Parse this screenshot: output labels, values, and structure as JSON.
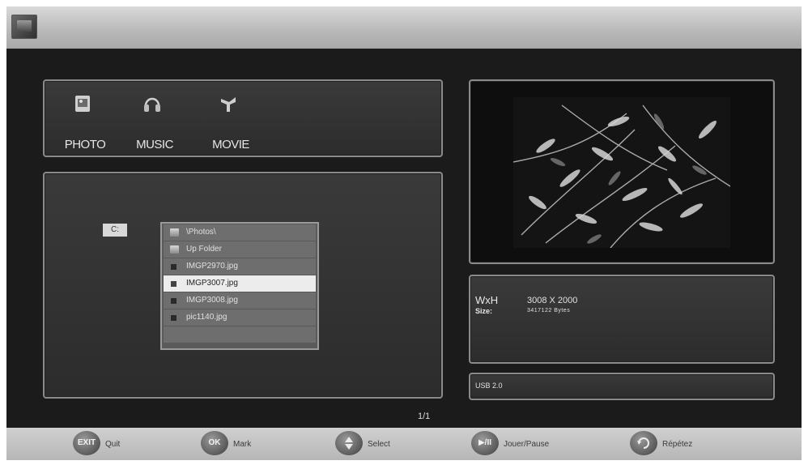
{
  "media_tabs": [
    {
      "label": "PHOTO",
      "icon": "photo-icon"
    },
    {
      "label": "MUSIC",
      "icon": "headphones-icon"
    },
    {
      "label": "MOVIE",
      "icon": "movie-icon"
    }
  ],
  "browser": {
    "drive": "C:",
    "files": [
      {
        "name": "\\Photos\\",
        "icon": "folder-icon"
      },
      {
        "name": "Up Folder",
        "icon": "up-folder-icon"
      },
      {
        "name": "IMGP2970.jpg",
        "icon": "file-icon"
      },
      {
        "name": "IMGP3007.jpg",
        "icon": "file-icon",
        "selected": true
      },
      {
        "name": "IMGP3008.jpg",
        "icon": "file-icon"
      },
      {
        "name": "pic1140.jpg",
        "icon": "file-icon"
      }
    ],
    "page": "1/1"
  },
  "info": {
    "wxh_label": "WxH",
    "wxh_value": "3008 X 2000",
    "size_label": "Size:",
    "size_value": "3417122 Bytes"
  },
  "device": "USB 2.0",
  "help": [
    {
      "button": "EXIT",
      "label": "Quit"
    },
    {
      "button": "OK",
      "label": "Mark"
    },
    {
      "button": "",
      "label": "Select"
    },
    {
      "button": "▶/II",
      "label": "Jouer/Pause"
    },
    {
      "button": "",
      "label": "Répétez"
    }
  ]
}
